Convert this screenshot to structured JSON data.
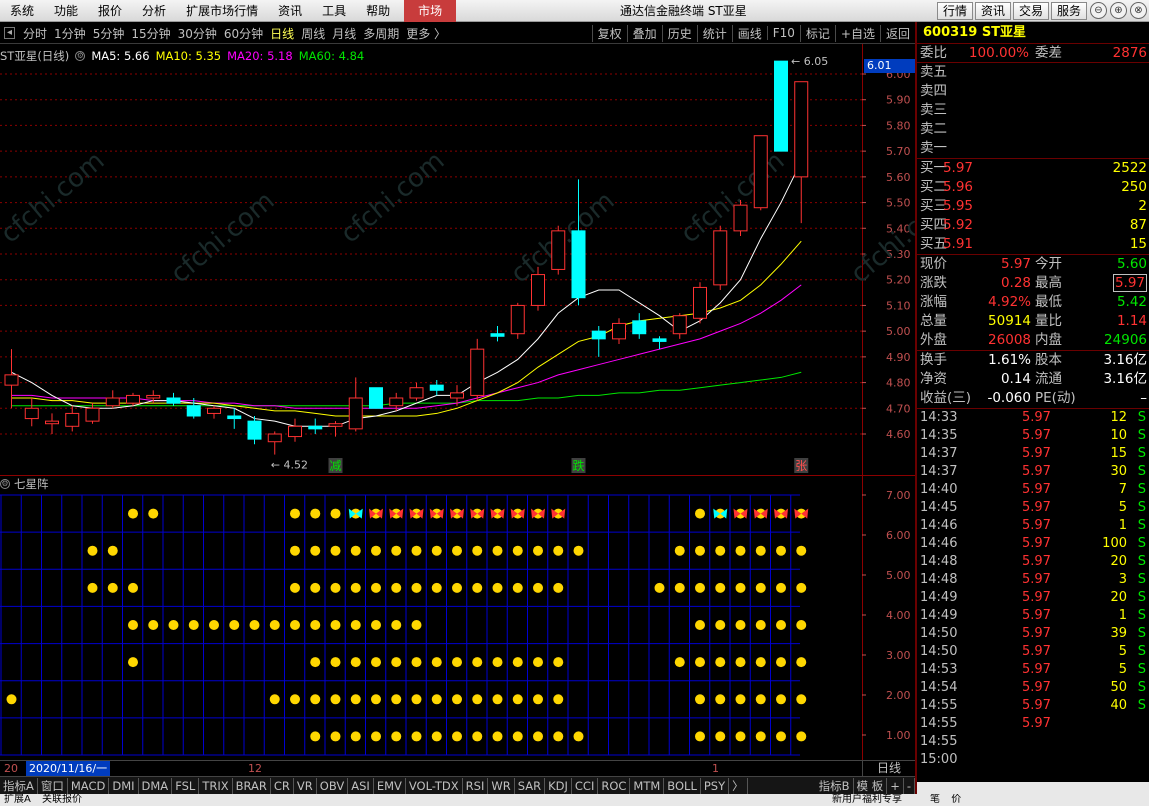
{
  "menu": [
    "系统",
    "功能",
    "报价",
    "分析",
    "扩展市场行情",
    "资讯",
    "工具",
    "帮助",
    "市场"
  ],
  "app_title": "通达信金融终端 ST亚星",
  "title_buttons": [
    "行情",
    "资讯",
    "交易",
    "服务"
  ],
  "window_controls": [
    "⊖",
    "⊕",
    "⊗"
  ],
  "periods": [
    "分时",
    "1分钟",
    "5分钟",
    "15分钟",
    "30分钟",
    "60分钟",
    "日线",
    "周线",
    "月线",
    "多周期",
    "更多 〉"
  ],
  "active_period": "日线",
  "tools": [
    "复权",
    "叠加",
    "历史",
    "统计",
    "画线",
    "F10",
    "标记",
    "+自选",
    "返回"
  ],
  "kline_legend": {
    "name": "ST亚星(日线)",
    "ma5": "MA5: 5.66",
    "ma10": "MA10: 5.35",
    "ma20": "MA20: 5.18",
    "ma60": "MA60: 4.84"
  },
  "indicator_legend": {
    "name": "七星阵"
  },
  "current_price_tag": "6.01",
  "high_label": "6.05",
  "low_label": "4.52",
  "markers": [
    {
      "i": 16,
      "text": "减"
    },
    {
      "i": 28,
      "text": "跌"
    },
    {
      "i": 39,
      "text": "张"
    }
  ],
  "price_axis": [
    "6.00",
    "5.90",
    "5.80",
    "5.70",
    "5.60",
    "5.50",
    "5.40",
    "5.30",
    "5.20",
    "5.10",
    "5.00",
    "4.90",
    "4.80",
    "4.70",
    "4.60"
  ],
  "indicator_axis": [
    "7.00",
    "6.00",
    "5.00",
    "4.00",
    "3.00",
    "2.00",
    "1.00"
  ],
  "colors": {
    "up": "#ff3232",
    "down": "#00ffff",
    "ma5": "#ffffff",
    "ma10": "#ffff00",
    "ma20": "#ff00ff",
    "ma60": "#00e600",
    "grid_red": "#8b0000",
    "grid_blue": "#0000d0",
    "dot": "#ffd700"
  },
  "chart_data": {
    "type": "candlestick",
    "ohlc": [
      [
        4.79,
        4.93,
        4.7,
        4.83
      ],
      [
        4.66,
        4.74,
        4.63,
        4.7
      ],
      [
        4.64,
        4.68,
        4.6,
        4.65
      ],
      [
        4.63,
        4.71,
        4.61,
        4.68
      ],
      [
        4.65,
        4.72,
        4.64,
        4.7
      ],
      [
        4.71,
        4.77,
        4.7,
        4.74
      ],
      [
        4.72,
        4.76,
        4.71,
        4.75
      ],
      [
        4.74,
        4.77,
        4.72,
        4.75
      ],
      [
        4.74,
        4.76,
        4.71,
        4.72
      ],
      [
        4.71,
        4.74,
        4.66,
        4.67
      ],
      [
        4.68,
        4.71,
        4.66,
        4.7
      ],
      [
        4.67,
        4.7,
        4.62,
        4.66
      ],
      [
        4.65,
        4.67,
        4.56,
        4.58
      ],
      [
        4.57,
        4.61,
        4.52,
        4.6
      ],
      [
        4.59,
        4.66,
        4.57,
        4.63
      ],
      [
        4.63,
        4.66,
        4.6,
        4.62
      ],
      [
        4.63,
        4.65,
        4.59,
        4.64
      ],
      [
        4.62,
        4.82,
        4.61,
        4.74
      ],
      [
        4.78,
        4.78,
        4.7,
        4.7
      ],
      [
        4.71,
        4.76,
        4.69,
        4.74
      ],
      [
        4.74,
        4.8,
        4.73,
        4.78
      ],
      [
        4.79,
        4.81,
        4.75,
        4.77
      ],
      [
        4.74,
        4.79,
        4.71,
        4.76
      ],
      [
        4.75,
        4.97,
        4.73,
        4.93
      ],
      [
        4.99,
        5.02,
        4.96,
        4.98
      ],
      [
        4.99,
        5.11,
        4.97,
        5.1
      ],
      [
        5.1,
        5.25,
        5.08,
        5.22
      ],
      [
        5.24,
        5.41,
        5.22,
        5.39
      ],
      [
        5.39,
        5.59,
        5.1,
        5.13
      ],
      [
        5.0,
        5.02,
        4.9,
        4.97
      ],
      [
        4.97,
        5.05,
        4.95,
        5.03
      ],
      [
        5.04,
        5.07,
        4.97,
        4.99
      ],
      [
        4.97,
        4.98,
        4.93,
        4.96
      ],
      [
        4.99,
        5.07,
        4.97,
        5.06
      ],
      [
        5.05,
        5.19,
        5.03,
        5.17
      ],
      [
        5.18,
        5.41,
        5.16,
        5.39
      ],
      [
        5.39,
        5.51,
        5.37,
        5.49
      ],
      [
        5.48,
        5.76,
        5.47,
        5.76
      ],
      [
        6.05,
        6.05,
        5.7,
        5.7
      ],
      [
        5.6,
        5.97,
        5.42,
        5.97
      ]
    ],
    "ma5": [
      4.84,
      4.8,
      4.75,
      4.71,
      4.7,
      4.7,
      4.71,
      4.73,
      4.73,
      4.72,
      4.71,
      4.7,
      4.66,
      4.65,
      4.63,
      4.63,
      4.63,
      4.66,
      4.67,
      4.69,
      4.72,
      4.75,
      4.75,
      4.8,
      4.84,
      4.89,
      4.97,
      5.07,
      5.13,
      5.16,
      5.16,
      5.11,
      5.06,
      5.0,
      5.04,
      5.11,
      5.2,
      5.36,
      5.5,
      5.66
    ],
    "ma10": [
      4.74,
      4.74,
      4.73,
      4.73,
      4.72,
      4.72,
      4.72,
      4.72,
      4.72,
      4.72,
      4.72,
      4.71,
      4.7,
      4.69,
      4.69,
      4.68,
      4.67,
      4.67,
      4.67,
      4.67,
      4.67,
      4.68,
      4.7,
      4.73,
      4.76,
      4.8,
      4.86,
      4.91,
      4.96,
      4.98,
      5.02,
      5.04,
      5.05,
      5.06,
      5.07,
      5.09,
      5.12,
      5.18,
      5.26,
      5.35
    ],
    "ma20": [
      4.75,
      4.75,
      4.74,
      4.74,
      4.74,
      4.74,
      4.74,
      4.73,
      4.73,
      4.73,
      4.72,
      4.72,
      4.71,
      4.71,
      4.7,
      4.7,
      4.7,
      4.7,
      4.7,
      4.7,
      4.7,
      4.71,
      4.72,
      4.74,
      4.76,
      4.78,
      4.8,
      4.83,
      4.85,
      4.87,
      4.89,
      4.91,
      4.93,
      4.95,
      4.97,
      5.0,
      5.03,
      5.07,
      5.12,
      5.18
    ],
    "ma60": [
      4.71,
      4.71,
      4.71,
      4.71,
      4.71,
      4.71,
      4.71,
      4.71,
      4.71,
      4.71,
      4.71,
      4.71,
      4.71,
      4.71,
      4.71,
      4.71,
      4.71,
      4.71,
      4.71,
      4.72,
      4.72,
      4.72,
      4.72,
      4.73,
      4.73,
      4.73,
      4.74,
      4.74,
      4.75,
      4.75,
      4.76,
      4.76,
      4.77,
      4.77,
      4.78,
      4.79,
      4.8,
      4.81,
      4.82,
      4.84
    ],
    "qixing_dots": [
      [
        0,
        1
      ],
      [
        6,
        2
      ],
      [
        6,
        4
      ],
      [
        6,
        6
      ],
      [
        7,
        6
      ],
      [
        4,
        5
      ],
      [
        5,
        5
      ],
      [
        6,
        3
      ],
      [
        7,
        3
      ],
      [
        8,
        3
      ],
      [
        9,
        3
      ],
      [
        10,
        3
      ],
      [
        11,
        3
      ],
      [
        12,
        3
      ],
      [
        13,
        3
      ],
      [
        14,
        3
      ],
      [
        15,
        3
      ],
      [
        16,
        3
      ],
      [
        17,
        3
      ],
      [
        18,
        3
      ],
      [
        19,
        3
      ],
      [
        20,
        3
      ],
      [
        4,
        4
      ],
      [
        5,
        4
      ],
      [
        14,
        6
      ],
      [
        15,
        6
      ],
      [
        16,
        6
      ],
      [
        17,
        6
      ],
      [
        18,
        6
      ],
      [
        19,
        6
      ],
      [
        20,
        6
      ],
      [
        21,
        6
      ],
      [
        22,
        6
      ],
      [
        23,
        6
      ],
      [
        24,
        6
      ],
      [
        25,
        6
      ],
      [
        26,
        6
      ],
      [
        27,
        6
      ],
      [
        14,
        5
      ],
      [
        15,
        5
      ],
      [
        16,
        5
      ],
      [
        17,
        5
      ],
      [
        18,
        5
      ],
      [
        19,
        5
      ],
      [
        20,
        5
      ],
      [
        21,
        5
      ],
      [
        22,
        5
      ],
      [
        23,
        5
      ],
      [
        24,
        5
      ],
      [
        25,
        5
      ],
      [
        26,
        5
      ],
      [
        27,
        5
      ],
      [
        28,
        5
      ],
      [
        14,
        4
      ],
      [
        15,
        4
      ],
      [
        16,
        4
      ],
      [
        17,
        4
      ],
      [
        18,
        4
      ],
      [
        19,
        4
      ],
      [
        20,
        4
      ],
      [
        21,
        4
      ],
      [
        22,
        4
      ],
      [
        23,
        4
      ],
      [
        24,
        4
      ],
      [
        25,
        4
      ],
      [
        26,
        4
      ],
      [
        27,
        4
      ],
      [
        13,
        3
      ],
      [
        17,
        4
      ],
      [
        18,
        4
      ],
      [
        15,
        2
      ],
      [
        16,
        2
      ],
      [
        17,
        2
      ],
      [
        18,
        2
      ],
      [
        19,
        2
      ],
      [
        20,
        2
      ],
      [
        21,
        2
      ],
      [
        22,
        2
      ],
      [
        23,
        2
      ],
      [
        24,
        2
      ],
      [
        25,
        2
      ],
      [
        26,
        2
      ],
      [
        27,
        2
      ],
      [
        13,
        1
      ],
      [
        14,
        1
      ],
      [
        15,
        1
      ],
      [
        16,
        1
      ],
      [
        17,
        1
      ],
      [
        18,
        1
      ],
      [
        19,
        1
      ],
      [
        20,
        1
      ],
      [
        21,
        1
      ],
      [
        22,
        1
      ],
      [
        23,
        1
      ],
      [
        24,
        1
      ],
      [
        25,
        1
      ],
      [
        26,
        1
      ],
      [
        27,
        1
      ],
      [
        15,
        0
      ],
      [
        16,
        0
      ],
      [
        17,
        0
      ],
      [
        18,
        0
      ],
      [
        19,
        0
      ],
      [
        20,
        0
      ],
      [
        21,
        0
      ],
      [
        22,
        0
      ],
      [
        23,
        0
      ],
      [
        24,
        0
      ],
      [
        25,
        0
      ],
      [
        26,
        0
      ],
      [
        27,
        0
      ],
      [
        28,
        0
      ],
      [
        32,
        4
      ],
      [
        33,
        5
      ],
      [
        34,
        5
      ],
      [
        35,
        5
      ],
      [
        36,
        5
      ],
      [
        37,
        5
      ],
      [
        38,
        5
      ],
      [
        39,
        5
      ],
      [
        33,
        4
      ],
      [
        34,
        4
      ],
      [
        35,
        4
      ],
      [
        36,
        4
      ],
      [
        37,
        4
      ],
      [
        38,
        4
      ],
      [
        39,
        4
      ],
      [
        34,
        3
      ],
      [
        35,
        3
      ],
      [
        36,
        3
      ],
      [
        37,
        3
      ],
      [
        38,
        3
      ],
      [
        39,
        3
      ],
      [
        33,
        2
      ],
      [
        34,
        2
      ],
      [
        35,
        2
      ],
      [
        36,
        2
      ],
      [
        37,
        2
      ],
      [
        38,
        2
      ],
      [
        39,
        2
      ],
      [
        34,
        1
      ],
      [
        35,
        1
      ],
      [
        36,
        1
      ],
      [
        37,
        1
      ],
      [
        38,
        1
      ],
      [
        39,
        1
      ],
      [
        34,
        0
      ],
      [
        35,
        0
      ],
      [
        36,
        0
      ],
      [
        37,
        0
      ],
      [
        38,
        0
      ],
      [
        39,
        0
      ],
      [
        34,
        6
      ],
      [
        35,
        6
      ],
      [
        36,
        6
      ],
      [
        37,
        6
      ],
      [
        38,
        6
      ],
      [
        39,
        6
      ],
      [
        6,
        2
      ]
    ],
    "butterflies": [
      {
        "i": 17,
        "c": "#00ffff"
      },
      {
        "i": 18,
        "c": "#ff3232"
      },
      {
        "i": 19,
        "c": "#ff3232"
      },
      {
        "i": 20,
        "c": "#ff3232"
      },
      {
        "i": 21,
        "c": "#ff3232"
      },
      {
        "i": 22,
        "c": "#ff3232"
      },
      {
        "i": 23,
        "c": "#ff3232"
      },
      {
        "i": 24,
        "c": "#ff3232"
      },
      {
        "i": 25,
        "c": "#ff3232"
      },
      {
        "i": 26,
        "c": "#ff3232"
      },
      {
        "i": 27,
        "c": "#ff3232"
      },
      {
        "i": 35,
        "c": "#00ffff"
      },
      {
        "i": 36,
        "c": "#ff3232"
      },
      {
        "i": 37,
        "c": "#ff3232"
      },
      {
        "i": 38,
        "c": "#ff3232"
      },
      {
        "i": 39,
        "c": "#ff3232"
      }
    ]
  },
  "date_axis": {
    "cursor_date": "2020/11/16/一",
    "left_tick": "20",
    "mid_tick": "12",
    "right_tick": "1",
    "period": "日线"
  },
  "indicator_tabs": [
    "指标A",
    "窗口",
    "MACD",
    "DMI",
    "DMA",
    "FSL",
    "TRIX",
    "BRAR",
    "CR",
    "VR",
    "OBV",
    "ASI",
    "EMV",
    "VOL-TDX",
    "RSI",
    "WR",
    "SAR",
    "KDJ",
    "CCI",
    "ROC",
    "MTM",
    "BOLL",
    "PSY",
    "〉",
    "指标B",
    "模 板",
    "+",
    "-"
  ],
  "status": {
    "left": "扩展A",
    "left2": "关联报价",
    "right": "新用户福利专享",
    "right2": "笔",
    "right3": "价"
  },
  "panel": {
    "code": "600319",
    "name": "ST亚星",
    "weibi_label": "委比",
    "weibi": "100.00%",
    "weicha_label": "委差",
    "weicha": "2876",
    "asks": [
      {
        "label": "卖五",
        "price": "",
        "vol": ""
      },
      {
        "label": "卖四",
        "price": "",
        "vol": ""
      },
      {
        "label": "卖三",
        "price": "",
        "vol": ""
      },
      {
        "label": "卖二",
        "price": "",
        "vol": ""
      },
      {
        "label": "卖一",
        "price": "",
        "vol": ""
      }
    ],
    "bids": [
      {
        "label": "买一",
        "price": "5.97",
        "vol": "2522"
      },
      {
        "label": "买二",
        "price": "5.96",
        "vol": "250"
      },
      {
        "label": "买三",
        "price": "5.95",
        "vol": "2"
      },
      {
        "label": "买四",
        "price": "5.92",
        "vol": "87"
      },
      {
        "label": "买五",
        "price": "5.91",
        "vol": "15"
      }
    ],
    "quote": [
      {
        "l1": "现价",
        "v1": "5.97",
        "c1": "red",
        "l2": "今开",
        "v2": "5.60",
        "c2": "green"
      },
      {
        "l1": "涨跌",
        "v1": "0.28",
        "c1": "red",
        "l2": "最高",
        "v2": "5.97",
        "c2": "red boxed"
      },
      {
        "l1": "涨幅",
        "v1": "4.92%",
        "c1": "red",
        "l2": "最低",
        "v2": "5.42",
        "c2": "green"
      },
      {
        "l1": "总量",
        "v1": "50914",
        "c1": "yellow",
        "l2": "量比",
        "v2": "1.14",
        "c2": "red"
      },
      {
        "l1": "外盘",
        "v1": "26008",
        "c1": "red",
        "l2": "内盘",
        "v2": "24906",
        "c2": "green"
      }
    ],
    "fund": [
      {
        "l1": "换手",
        "v1": "1.61%",
        "l2": "股本",
        "v2": "3.16亿"
      },
      {
        "l1": "净资",
        "v1": "0.14",
        "l2": "流通",
        "v2": "3.16亿"
      },
      {
        "l1": "收益(三)",
        "v1": "-0.060",
        "l2": "PE(动)",
        "v2": "–"
      }
    ],
    "ticks": [
      {
        "t": "14:33",
        "p": "5.97",
        "q": "12",
        "s": "S"
      },
      {
        "t": "14:35",
        "p": "5.97",
        "q": "10",
        "s": "S"
      },
      {
        "t": "14:37",
        "p": "5.97",
        "q": "15",
        "s": "S"
      },
      {
        "t": "14:37",
        "p": "5.97",
        "q": "30",
        "s": "S"
      },
      {
        "t": "14:40",
        "p": "5.97",
        "q": "7",
        "s": "S"
      },
      {
        "t": "14:45",
        "p": "5.97",
        "q": "5",
        "s": "S"
      },
      {
        "t": "14:46",
        "p": "5.97",
        "q": "1",
        "s": "S"
      },
      {
        "t": "14:46",
        "p": "5.97",
        "q": "100",
        "s": "S"
      },
      {
        "t": "14:48",
        "p": "5.97",
        "q": "20",
        "s": "S"
      },
      {
        "t": "14:48",
        "p": "5.97",
        "q": "3",
        "s": "S"
      },
      {
        "t": "14:49",
        "p": "5.97",
        "q": "20",
        "s": "S"
      },
      {
        "t": "14:49",
        "p": "5.97",
        "q": "1",
        "s": "S"
      },
      {
        "t": "14:50",
        "p": "5.97",
        "q": "39",
        "s": "S"
      },
      {
        "t": "14:50",
        "p": "5.97",
        "q": "5",
        "s": "S"
      },
      {
        "t": "14:53",
        "p": "5.97",
        "q": "5",
        "s": "S"
      },
      {
        "t": "14:54",
        "p": "5.97",
        "q": "50",
        "s": "S"
      },
      {
        "t": "14:55",
        "p": "5.97",
        "q": "40",
        "s": "S"
      },
      {
        "t": "14:55",
        "p": "5.97",
        "q": "",
        "s": ""
      },
      {
        "t": "14:55",
        "p": "",
        "q": "",
        "s": ""
      },
      {
        "t": "15:00",
        "p": "",
        "q": "",
        "s": ""
      }
    ]
  }
}
